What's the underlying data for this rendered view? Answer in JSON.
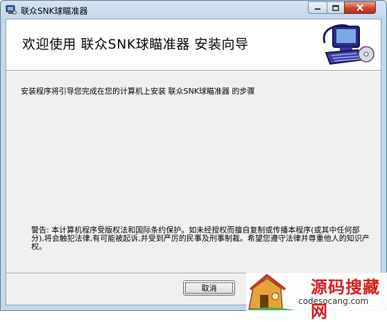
{
  "window": {
    "title": "联众SNK球瞄准器",
    "controls": {
      "minimize": "minimize",
      "maximize": "maximize",
      "close": "close"
    }
  },
  "header": {
    "title": "欢迎使用  联众SNK球瞄准器  安装向导",
    "icon": "computer-install-icon"
  },
  "body": {
    "intro": "安装程序将引导您完成在您的计算机上安装 联众SNK球瞄准器 的步骤",
    "warning": "警告: 本计算机程序受版权法和国际条约保护。如未经授权而擅自复制或传播本程序(或其中任何部分),将会触犯法律,有可能被起诉,并受到严厉的民事及刑事制裁。希望您遵守法律并尊重他人的知识产权。"
  },
  "buttons": {
    "cancel": "取消"
  },
  "watermark": {
    "brand": "源码搜藏网",
    "url": "codesocang.com"
  }
}
